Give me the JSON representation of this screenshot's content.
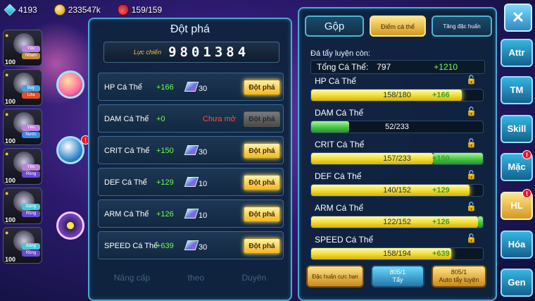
{
  "topbar": {
    "gems": "4193",
    "gold": "233547k",
    "stamina": "159/159"
  },
  "roster": [
    {
      "level": "100",
      "tags": [
        "Yêu",
        "Nham"
      ],
      "colors": [
        "#c084e0",
        "#c58a3a"
      ]
    },
    {
      "level": "100",
      "tags": [
        "Bay",
        "Lửa"
      ],
      "colors": [
        "#4aa0e0",
        "#e0502a"
      ]
    },
    {
      "level": "100",
      "tags": [
        "Yêu",
        "Nước"
      ],
      "colors": [
        "#c084e0",
        "#3a8ae0"
      ]
    },
    {
      "level": "100",
      "tags": [
        "Yêu",
        "Rồng"
      ],
      "colors": [
        "#c084e0",
        "#6a4ad0"
      ]
    },
    {
      "level": "100",
      "tags": [
        "Băng",
        "Rồng"
      ],
      "colors": [
        "#4ac8d8",
        "#6a4ad0"
      ]
    },
    {
      "level": "100",
      "tags": [
        "Băng",
        "Rồng"
      ],
      "colors": [
        "#4ac8d8",
        "#6a4ad0"
      ]
    }
  ],
  "breakthrough": {
    "title": "Đột phá",
    "power_label": "Lực chiến",
    "power_value": "9801384",
    "button_label": "Đột phá",
    "rows": [
      {
        "name": "HP Cá Thể",
        "bonus": "+166",
        "cost": "30",
        "status": "",
        "enabled": true
      },
      {
        "name": "DAM Cá Thể",
        "bonus": "+0",
        "cost": "",
        "status": "Chưa mở",
        "enabled": false
      },
      {
        "name": "CRIT Cá Thể",
        "bonus": "+150",
        "cost": "30",
        "status": "",
        "enabled": true
      },
      {
        "name": "DEF Cá Thể",
        "bonus": "+129",
        "cost": "10",
        "status": "",
        "enabled": true
      },
      {
        "name": "ARM Cá Thể",
        "bonus": "+126",
        "cost": "10",
        "status": "",
        "enabled": true
      },
      {
        "name": "SPEED Cá Thể",
        "bonus": "+639",
        "cost": "30",
        "status": "",
        "enabled": true
      }
    ],
    "bottom_nav": [
      "Nâng cấp",
      "theo",
      "Duyên"
    ]
  },
  "training": {
    "tabs": [
      "Gộp",
      "Điểm cá thể",
      "Tăng đặc huấn"
    ],
    "active_tab": 1,
    "remaining_label": "Đá tẩy luyện còn:",
    "total_label": "Tổng Cá Thể:",
    "total_value": "797",
    "total_bonus": "+1210",
    "stats": [
      {
        "name": "HP Cá Thể",
        "value": "158/180",
        "add": "+166",
        "fill": 0.878,
        "style": "y"
      },
      {
        "name": "DAM Cá Thể",
        "value": "52/233",
        "add": "",
        "fill": 0.223,
        "style": "g"
      },
      {
        "name": "CRIT Cá Thể",
        "value": "157/233",
        "add": "+150",
        "fill": 1.0,
        "style": "g"
      },
      {
        "name": "DEF Cá Thể",
        "value": "140/152",
        "add": "+129",
        "fill": 0.921,
        "style": "y"
      },
      {
        "name": "ARM Cá Thể",
        "value": "122/152",
        "add": "+126",
        "fill": 1.0,
        "style": "yg"
      },
      {
        "name": "SPEED Cá Thể",
        "value": "158/194",
        "add": "+639",
        "fill": 0.814,
        "style": "y"
      }
    ],
    "actions": {
      "special": "Đặc huấn cực hạn",
      "wash_count": "805/1",
      "wash_label": "Tẩy",
      "auto_count": "805/1",
      "auto_label": "Auto tẩy luyện"
    }
  },
  "side_buttons": [
    {
      "label": "Attr",
      "badge": ""
    },
    {
      "label": "TM",
      "badge": ""
    },
    {
      "label": "Skill",
      "badge": ""
    },
    {
      "label": "Mặc",
      "badge": "!"
    },
    {
      "label": "HL",
      "badge": "!"
    },
    {
      "label": "Hóa",
      "badge": ""
    },
    {
      "label": "Gen",
      "badge": ""
    }
  ],
  "close_icon": "close-icon"
}
